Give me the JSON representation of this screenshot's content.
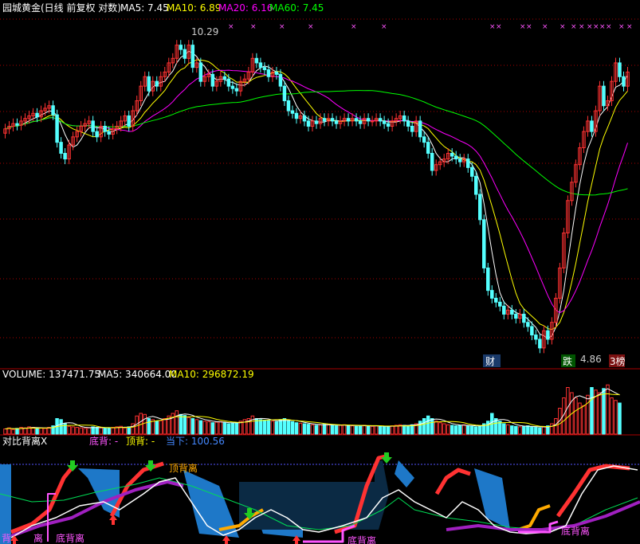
{
  "colors": {
    "up": "#ff3232",
    "down": "#54ffff",
    "ma5": "#ffffff",
    "ma10": "#ffff00",
    "ma20": "#ff00ff",
    "ma60": "#00ff00",
    "grid": "#aa0000",
    "marker": "#ff55ff",
    "panel_blue": "#1e78c8",
    "panel_dark": "#0b2a44",
    "green_blob": "#2a9d2a",
    "orange_blob": "#ffaa00",
    "purple_line": "#a020c0"
  },
  "header": {
    "name": "园城黄金(日线 前复权 对数)",
    "ma5": "MA5: 7.45",
    "ma10": "MA10: 6.89",
    "ma20": "MA20: 6.16",
    "ma60": "MA60: 7.45"
  },
  "volume_header": {
    "volume": "VOLUME: 137471.75",
    "ma5": "MA5: 340664.00",
    "ma10": "MA10: 296872.19"
  },
  "indicator_header": {
    "name": "对比背离X",
    "bottom": "底背: -",
    "top": "顶背: -",
    "current": "当下: 100.56"
  },
  "annotations": {
    "high": "10.29",
    "low": "4.86",
    "tag_fin": "财",
    "tag_fall": "跌",
    "tag_list": "3榜",
    "top_div": "顶背离",
    "bot_div1": "底背离",
    "bot_div2": "底背离",
    "bot_div3": "底背离",
    "left_cut": "背",
    "left_cut2": "离"
  },
  "chart_data": [
    {
      "type": "candlestick",
      "title": "园城黄金(日线 前复权 对数)",
      "x": [
        1,
        2,
        3,
        4,
        5,
        6,
        7,
        8,
        9,
        10,
        11,
        12,
        13,
        14,
        15,
        16,
        17,
        18,
        19,
        20,
        21,
        22,
        23,
        24,
        25,
        26,
        27,
        28,
        29,
        30,
        31,
        32,
        33,
        34,
        35,
        36,
        37,
        38,
        39,
        40,
        41,
        42,
        43,
        44,
        45,
        46,
        47,
        48,
        49,
        50,
        51,
        52,
        53,
        54,
        55,
        56,
        57,
        58,
        59,
        60,
        61,
        62,
        63,
        64,
        65,
        66,
        67,
        68,
        69,
        70,
        71,
        72,
        73,
        74,
        75,
        76,
        77,
        78,
        79,
        80,
        81,
        82,
        83,
        84,
        85,
        86,
        87,
        88,
        89,
        90,
        91,
        92,
        93,
        94,
        95,
        96,
        97,
        98,
        99,
        100,
        101,
        102,
        103,
        104,
        105,
        106,
        107,
        108,
        109,
        110,
        111,
        112,
        113,
        114,
        115,
        116,
        117,
        118,
        119,
        120,
        121,
        122,
        123,
        124,
        125,
        126,
        127,
        128,
        129,
        130,
        131,
        132,
        133,
        134,
        135,
        136,
        137,
        138,
        139,
        140,
        141,
        142,
        143,
        144,
        145,
        146,
        147,
        148,
        149,
        150,
        151,
        152,
        153,
        154,
        155,
        156,
        157,
        158,
        159,
        160,
        161
      ],
      "close": [
        8.15,
        8.2,
        8.25,
        8.22,
        8.3,
        8.35,
        8.4,
        8.45,
        8.38,
        8.5,
        8.55,
        8.6,
        8.42,
        7.9,
        7.7,
        7.6,
        7.85,
        8.0,
        8.1,
        8.2,
        8.25,
        8.3,
        8.1,
        8.0,
        8.2,
        8.1,
        8.05,
        8.15,
        8.2,
        8.3,
        8.4,
        8.2,
        8.5,
        8.7,
        9.0,
        9.2,
        8.9,
        9.1,
        9.0,
        9.2,
        9.3,
        9.5,
        9.6,
        9.9,
        9.8,
        9.6,
        9.9,
        9.4,
        9.5,
        9.1,
        9.2,
        9.25,
        9.0,
        9.1,
        9.2,
        9.15,
        9.0,
        8.95,
        8.9,
        9.1,
        9.15,
        9.3,
        9.6,
        9.5,
        9.4,
        9.35,
        9.2,
        9.3,
        9.25,
        9.0,
        8.7,
        8.5,
        8.45,
        8.35,
        8.4,
        8.3,
        8.2,
        8.3,
        8.25,
        8.35,
        8.3,
        8.35,
        8.3,
        8.25,
        8.3,
        8.35,
        8.3,
        8.35,
        8.3,
        8.25,
        8.35,
        8.3,
        8.3,
        8.35,
        8.3,
        8.25,
        8.2,
        8.3,
        8.35,
        8.4,
        8.3,
        8.2,
        8.1,
        8.3,
        8.0,
        7.9,
        7.7,
        7.4,
        7.5,
        7.55,
        7.6,
        7.7,
        7.65,
        7.6,
        7.55,
        7.6,
        7.45,
        7.3,
        7.0,
        6.6,
        5.9,
        5.6,
        5.5,
        5.45,
        5.4,
        5.3,
        5.35,
        5.3,
        5.25,
        5.3,
        5.2,
        5.15,
        5.05,
        5.0,
        4.9,
        5.1,
        5.0,
        5.2,
        5.5,
        5.9,
        6.4,
        6.9,
        7.2,
        7.5,
        7.8,
        8.1,
        8.3,
        8.1,
        8.5,
        9.0,
        8.6,
        8.7,
        9.1,
        9.5,
        9.2,
        9.0,
        9.3
      ],
      "ylim": [
        4.8,
        10.4
      ],
      "yscale": "log"
    },
    {
      "type": "bar",
      "title": "VOLUME",
      "values": [
        10,
        12,
        9,
        11,
        13,
        12,
        14,
        13,
        10,
        12,
        11,
        13,
        16,
        30,
        28,
        20,
        15,
        14,
        13,
        12,
        11,
        12,
        14,
        13,
        12,
        11,
        12,
        13,
        14,
        15,
        12,
        14,
        20,
        35,
        40,
        38,
        30,
        28,
        25,
        26,
        30,
        35,
        40,
        45,
        38,
        36,
        32,
        30,
        28,
        26,
        25,
        24,
        22,
        23,
        24,
        22,
        20,
        21,
        22,
        25,
        28,
        30,
        35,
        30,
        28,
        27,
        26,
        25,
        24,
        28,
        30,
        26,
        24,
        22,
        21,
        20,
        19,
        18,
        17,
        18,
        19,
        18,
        17,
        16,
        17,
        18,
        17,
        16,
        15,
        16,
        17,
        16,
        15,
        16,
        15,
        14,
        15,
        16,
        17,
        18,
        17,
        16,
        18,
        20,
        25,
        30,
        35,
        30,
        25,
        22,
        20,
        18,
        17,
        16,
        17,
        18,
        16,
        15,
        14,
        16,
        20,
        25,
        40,
        30,
        25,
        20,
        18,
        16,
        15,
        14,
        15,
        16,
        14,
        13,
        12,
        14,
        16,
        20,
        30,
        50,
        70,
        90,
        80,
        70,
        60,
        55,
        75,
        90,
        85,
        80,
        88,
        95,
        70,
        65,
        60
      ],
      "ylim": [
        0,
        100
      ]
    }
  ]
}
